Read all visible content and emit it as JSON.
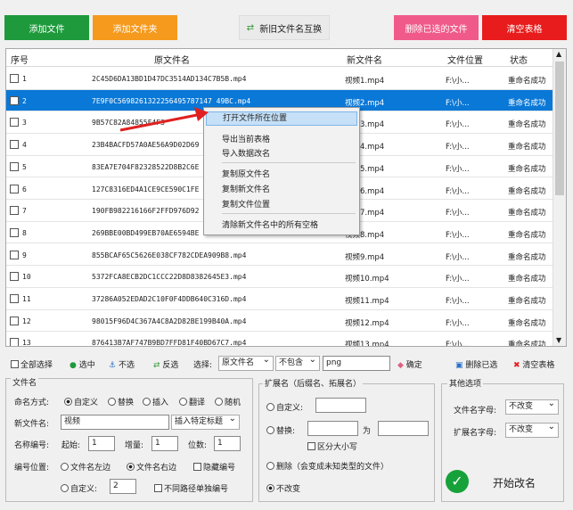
{
  "toolbar": {
    "add_file": "添加文件",
    "add_folder": "添加文件夹",
    "swap": "新旧文件名互换",
    "delete_selected": "删除已选的文件",
    "clear_table": "清空表格"
  },
  "colors": {
    "green": "#1e9a3c",
    "orange": "#f59a1d",
    "pink": "#f05a8a",
    "red": "#e81c1c",
    "selection": "#0a78d7"
  },
  "table": {
    "headers": [
      "序号",
      "原文件名",
      "新文件名",
      "文件位置",
      "状态"
    ],
    "rows": [
      [
        "1",
        "2C45D6DA13BD1D47DC3514AD134C7B5B.mp4",
        "视频1.mp4",
        "F:\\小...",
        "重命名成功"
      ],
      [
        "2",
        "7E9F0C5698261322256495787147 49BC.mp4",
        "视频2.mp4",
        "F:\\小...",
        "重命名成功"
      ],
      [
        "3",
        "9B57C82A84855F4F3",
        "视频3.mp4",
        "F:\\小...",
        "重命名成功"
      ],
      [
        "4",
        "23B4BACFD57A0AE56A9D02D69",
        "视频4.mp4",
        "F:\\小...",
        "重命名成功"
      ],
      [
        "5",
        "83EA7E704F82328522D8B2C6E",
        "视频5.mp4",
        "F:\\小...",
        "重命名成功"
      ],
      [
        "6",
        "127C8316ED4A1CE9CE590C1FE",
        "视频6.mp4",
        "F:\\小...",
        "重命名成功"
      ],
      [
        "7",
        "190FB982216166F2FFD976D92",
        "视频7.mp4",
        "F:\\小...",
        "重命名成功"
      ],
      [
        "8",
        "269BBE00BD499EB70AE6594BE",
        "视频8.mp4",
        "F:\\小...",
        "重命名成功"
      ],
      [
        "9",
        "855BCAF65C5626E038CF782CDEA909B8.mp4",
        "视频9.mp4",
        "F:\\小...",
        "重命名成功"
      ],
      [
        "10",
        "5372FCA8ECB2DC1CCC22D8D8382645E3.mp4",
        "视频10.mp4",
        "F:\\小...",
        "重命名成功"
      ],
      [
        "11",
        "37286A052EDAD2C10F0F4DDB640C316D.mp4",
        "视频11.mp4",
        "F:\\小...",
        "重命名成功"
      ],
      [
        "12",
        "98015F96D4C367A4C8A2D82BE199B40A.mp4",
        "视频12.mp4",
        "F:\\小...",
        "重命名成功"
      ],
      [
        "13",
        "876413B7AF747B9BD7FFD81F40BD67C7.mp4",
        "视频13.mp4",
        "F:\\小...",
        "重命名成功"
      ]
    ]
  },
  "menu": {
    "items": [
      "打开文件所在位置",
      "导出当前表格",
      "导入数据改名",
      "复制原文件名",
      "复制新文件名",
      "复制文件位置",
      "清除新文件名中的所有空格"
    ]
  },
  "filter": {
    "select_all": "全部选择",
    "select": "选中",
    "deselect": "不选",
    "invert": "反选",
    "choose": "选择:",
    "field": "原文件名",
    "mode": "不包含",
    "value": "png",
    "confirm": "确定",
    "delete_selected": "删除已选",
    "clear_table": "清空表格"
  },
  "filename": {
    "title": "文件名",
    "mode_label": "命名方式:",
    "modes": [
      "自定义",
      "替换",
      "插入",
      "翻译",
      "随机"
    ],
    "new_name_label": "新文件名:",
    "new_name": "视频",
    "insert_title": "插入特定标题",
    "num_label": "名称编号:",
    "start_label": "起始:",
    "start": "1",
    "inc_label": "增量:",
    "inc": "1",
    "digits_label": "位数:",
    "digits": "1",
    "pos_label": "编号位置:",
    "pos_left": "文件名左边",
    "pos_right": "文件名右边",
    "hide_num": "隐藏编号",
    "custom": "自定义:",
    "custom_val": "2",
    "separate": "不同路径单独编号"
  },
  "ext": {
    "title": "扩展名（后缀名、拓展名）",
    "custom": "自定义:",
    "replace": "替换:",
    "to": "为",
    "case": "区分大小写",
    "delete": "删除（会变成未知类型的文件）",
    "nochange": "不改变"
  },
  "other": {
    "title": "其他选项",
    "fn_case_label": "文件名字母:",
    "fn_case": "不改变",
    "ext_case_label": "扩展名字母:",
    "ext_case": "不改变",
    "start": "开始改名"
  }
}
